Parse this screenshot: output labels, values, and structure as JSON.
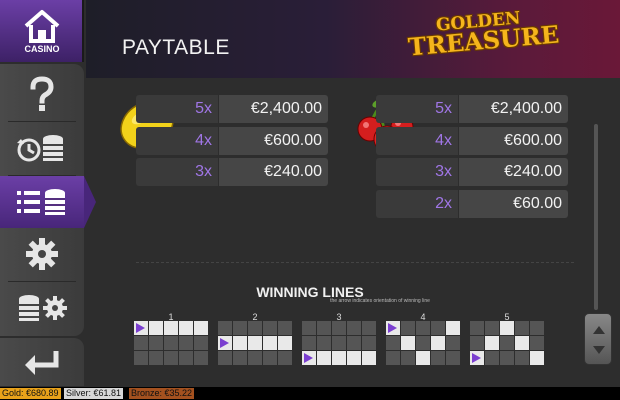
{
  "sidebar": {
    "casino_label": "CASINO",
    "items": [
      {
        "name": "help",
        "icon": "question-mark-icon"
      },
      {
        "name": "history",
        "icon": "history-chips-icon"
      },
      {
        "name": "paytable",
        "icon": "paytable-list-icon",
        "active": true
      },
      {
        "name": "settings",
        "icon": "gear-icon"
      },
      {
        "name": "game-settings",
        "icon": "chips-gear-icon"
      }
    ],
    "back_icon": "back-arrow-icon"
  },
  "header": {
    "title": "PAYTABLE",
    "logo_line1": "GOLDEN",
    "logo_line2": "TREASURE"
  },
  "paytable": {
    "lemon": [
      {
        "mult": "5x",
        "value": "€2,400.00"
      },
      {
        "mult": "4x",
        "value": "€600.00"
      },
      {
        "mult": "3x",
        "value": "€240.00"
      }
    ],
    "cherries": [
      {
        "mult": "5x",
        "value": "€2,400.00"
      },
      {
        "mult": "4x",
        "value": "€600.00"
      },
      {
        "mult": "3x",
        "value": "€240.00"
      },
      {
        "mult": "2x",
        "value": "€60.00"
      }
    ]
  },
  "winning_lines": {
    "title": "WINNING LINES",
    "subtitle": "the arrow indicates orientation of winning line",
    "lines": [
      {
        "num": "1",
        "rows": [
          1,
          1,
          1,
          1,
          1
        ]
      },
      {
        "num": "2",
        "rows": [
          2,
          2,
          2,
          2,
          2
        ]
      },
      {
        "num": "3",
        "rows": [
          3,
          3,
          3,
          3,
          3
        ]
      },
      {
        "num": "4",
        "rows": [
          1,
          2,
          3,
          2,
          1
        ]
      },
      {
        "num": "5",
        "rows": [
          3,
          2,
          1,
          2,
          3
        ]
      }
    ]
  },
  "jackpots": {
    "gold": "Gold: €680.89",
    "silver": "Silver: €61.81",
    "bronze": "Bronze: €35.22"
  },
  "colors": {
    "accent_purple": "#6b3fa6",
    "multiplier_text": "#a076e6",
    "gold": "#e8a21a",
    "silver": "#d8d8d8",
    "bronze": "#a4511f"
  }
}
